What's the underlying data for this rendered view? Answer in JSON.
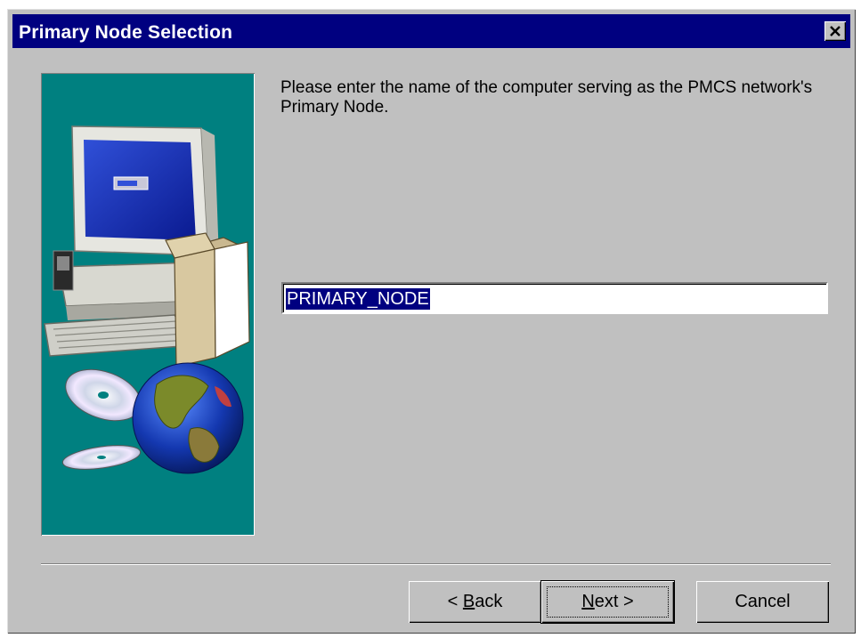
{
  "window": {
    "title": "Primary Node Selection",
    "close_icon": "close-icon"
  },
  "content": {
    "instruction": "Please enter the name of the computer serving as the PMCS network's Primary Node.",
    "primary_node_input": {
      "value": "PRIMARY_NODE",
      "selected": true
    }
  },
  "buttons": {
    "back": {
      "label": "< Back",
      "mnemonic": "B"
    },
    "next": {
      "label": "Next >",
      "mnemonic": "N"
    },
    "cancel": {
      "label": "Cancel"
    }
  },
  "colors": {
    "titlebar": "#000080",
    "dialog_bg": "#c0c0c0",
    "illustration_bg": "#008080",
    "selection_bg": "#000080"
  }
}
